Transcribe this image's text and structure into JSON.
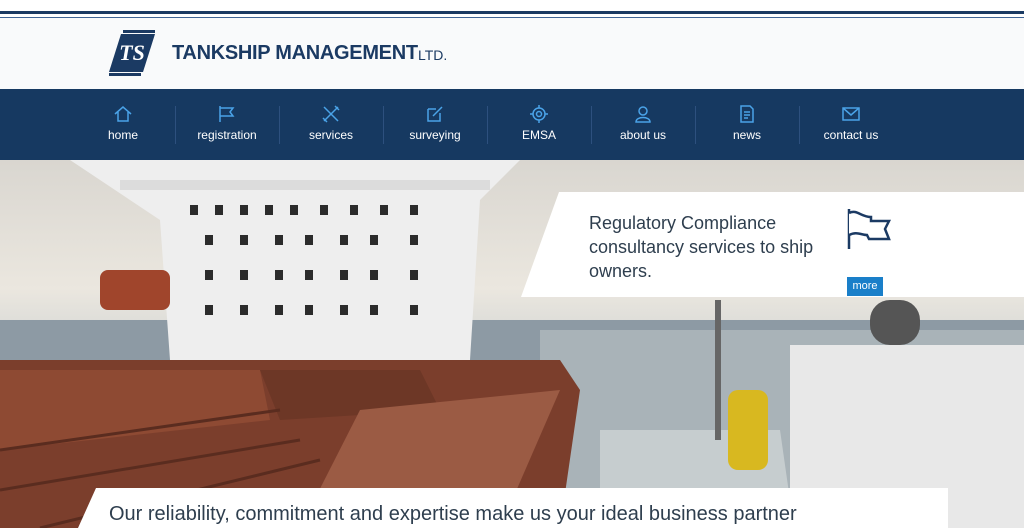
{
  "brand": {
    "name": "TANKSHIP MANAGEMENT",
    "suffix": "LTD.",
    "logo_text": "TS"
  },
  "nav": {
    "items": [
      {
        "label": "home",
        "icon": "home-icon"
      },
      {
        "label": "registration",
        "icon": "flag-icon"
      },
      {
        "label": "services",
        "icon": "tools-icon"
      },
      {
        "label": "surveying",
        "icon": "edit-icon"
      },
      {
        "label": "EMSA",
        "icon": "gear-icon"
      },
      {
        "label": "about us",
        "icon": "user-icon"
      },
      {
        "label": "news",
        "icon": "news-icon"
      },
      {
        "label": "contact us",
        "icon": "envelope-icon"
      }
    ]
  },
  "hero": {
    "slide_text": "Regulatory Compliance consultancy services to ship owners.",
    "slide_icon": "flag-icon",
    "more_label": "more",
    "tagline": "Our reliability, commitment and expertise make us your ideal business partner"
  },
  "colors": {
    "navy": "#163961",
    "accent": "#1a7fc9",
    "icon_blue": "#4aa3e8"
  }
}
